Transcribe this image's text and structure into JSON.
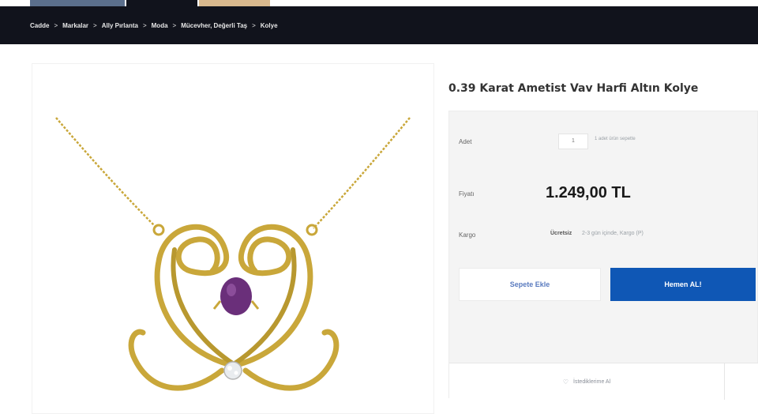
{
  "breadcrumb": {
    "items": [
      "Cadde",
      "Markalar",
      "Ally Pırlanta",
      "Moda",
      "Mücevher, Değerli Taş",
      "Kolye"
    ],
    "separator": ">"
  },
  "product": {
    "title": "0.39 Karat Ametist Vav Harfi Altın Kolye",
    "image_alt": "Vav harfi altın kolye, ametist taşlı"
  },
  "purchase": {
    "qty_label": "Adet",
    "qty_value": "1",
    "qty_note": "1 adet ürün sepette",
    "price_label": "Fiyatı",
    "price": "1.249,00 TL",
    "cargo_label": "Kargo",
    "cargo_free": "Ücretsiz",
    "cargo_info": "2-3 gün içinde, Kargo (P)",
    "add_to_cart": "Sepete Ekle",
    "buy_now": "Hemen AL!",
    "wishlist": "İstediklerime Al"
  },
  "colors": {
    "header_bg": "#11131c",
    "buy_button": "#0f57b5",
    "gold": "#c9a73a",
    "amethyst": "#6a2f7a"
  }
}
